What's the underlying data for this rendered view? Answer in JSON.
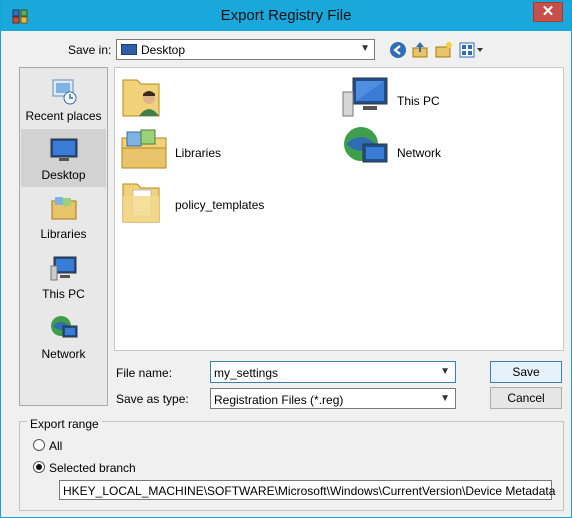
{
  "window": {
    "title": "Export Registry File",
    "close_glyph": "✕"
  },
  "save_in": {
    "label": "Save in:",
    "value": "Desktop"
  },
  "toolbar": {
    "icons": [
      "back-icon",
      "up-folder-icon",
      "new-folder-icon",
      "view-menu-icon"
    ]
  },
  "places": [
    {
      "label": "Recent places",
      "icon": "recent-places-icon"
    },
    {
      "label": "Desktop",
      "icon": "desktop-icon",
      "selected": true
    },
    {
      "label": "Libraries",
      "icon": "libraries-icon"
    },
    {
      "label": "This PC",
      "icon": "this-pc-icon"
    },
    {
      "label": "Network",
      "icon": "network-icon"
    }
  ],
  "files": [
    {
      "label": "",
      "icon": "user-folder-icon"
    },
    {
      "label": "This PC",
      "icon": "this-pc-icon"
    },
    {
      "label": "Libraries",
      "icon": "libraries-icon"
    },
    {
      "label": "Network",
      "icon": "network-icon"
    },
    {
      "label": "policy_templates",
      "icon": "folder-icon"
    }
  ],
  "file_name": {
    "label": "File name:",
    "value": "my_settings"
  },
  "save_as_type": {
    "label": "Save as type:",
    "value": "Registration Files (*.reg)"
  },
  "buttons": {
    "save": "Save",
    "cancel": "Cancel"
  },
  "export_range": {
    "title": "Export range",
    "all_label": "All",
    "selected_label": "Selected branch",
    "selected": "Selected branch",
    "branch_path": "HKEY_LOCAL_MACHINE\\SOFTWARE\\Microsoft\\Windows\\CurrentVersion\\Device Metadata"
  }
}
